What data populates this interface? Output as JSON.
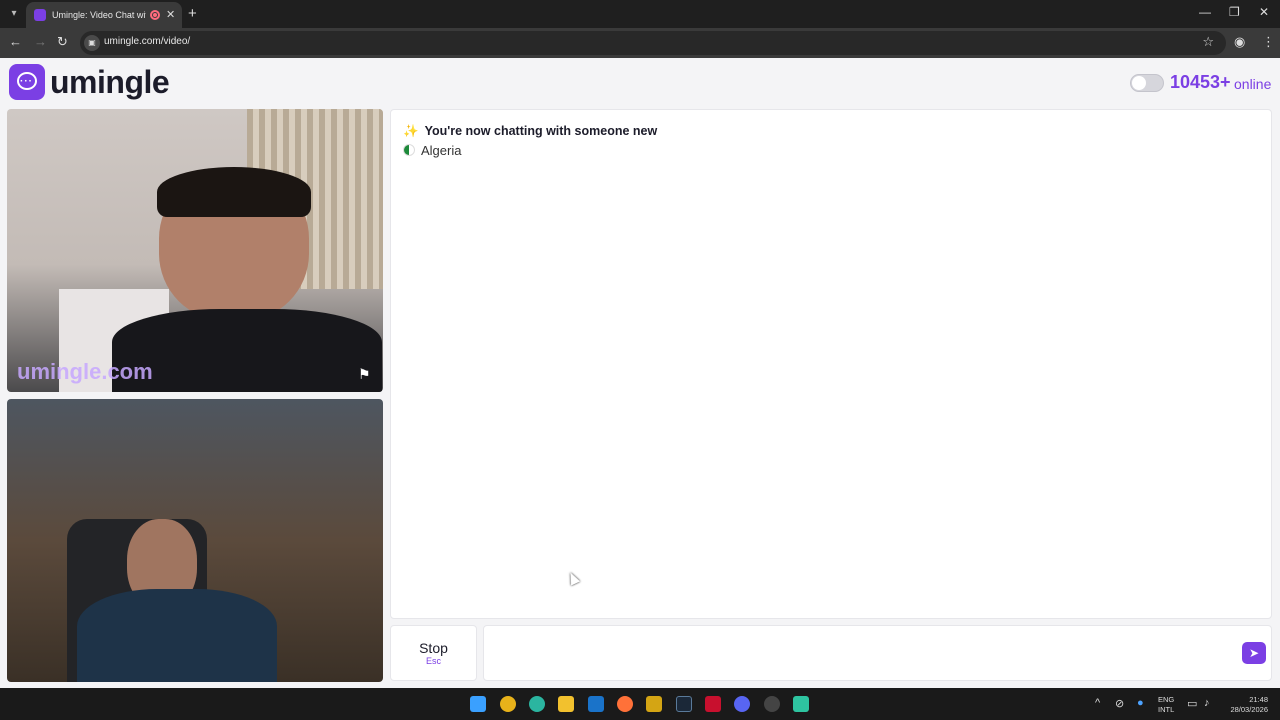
{
  "browser": {
    "tab_title": "Umingle: Video Chat with S",
    "url": "umingle.com/video/",
    "tab_close": "✕",
    "new_tab": "+"
  },
  "header": {
    "logo_text": "umingle",
    "online_count": "10453+",
    "online_label": "online"
  },
  "video": {
    "watermark": "umingle.com"
  },
  "chat": {
    "notice": "You're now chatting with someone new",
    "country": "Algeria"
  },
  "controls": {
    "stop_label": "Stop",
    "stop_key": "Esc"
  },
  "taskbar": {
    "lang_line1": "ENG",
    "lang_line2": "INTL",
    "time": "21:48",
    "date": "28/03/2026"
  },
  "colors": {
    "accent": "#7b3fe4"
  }
}
